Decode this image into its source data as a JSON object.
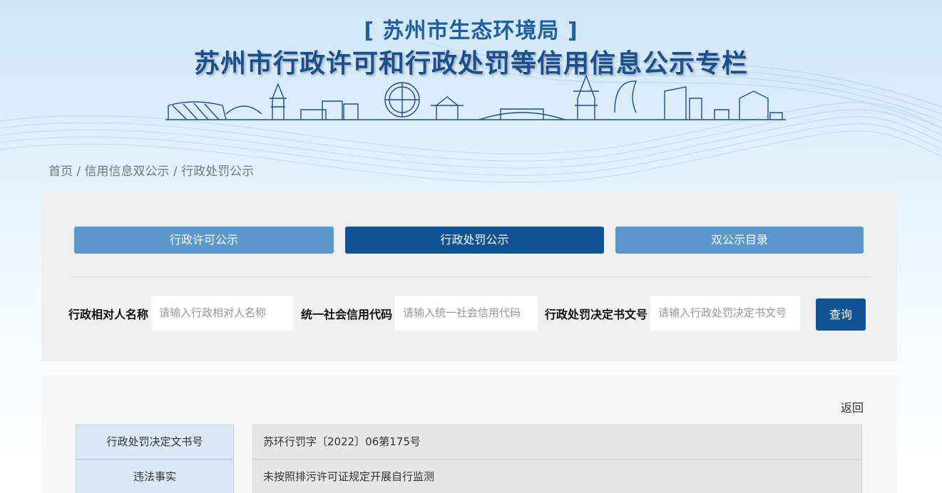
{
  "header": {
    "org": "[ 苏州市生态环境局 ]",
    "title": "苏州市行政许可和行政处罚等信用信息公示专栏"
  },
  "breadcrumb": {
    "home": "首页",
    "sep1": " / ",
    "section": "信用信息双公示",
    "sep2": " / ",
    "current": "行政处罚公示"
  },
  "tabs": [
    {
      "label": "行政许可公示",
      "active": false
    },
    {
      "label": "行政处罚公示",
      "active": true
    },
    {
      "label": "双公示目录",
      "active": false
    }
  ],
  "search": {
    "name_label": "行政相对人名称",
    "name_placeholder": "请输入行政相对人名称",
    "code_label": "统一社会信用代码",
    "code_placeholder": "请输入统一社会信用代码",
    "doc_label": "行政处罚决定书文号",
    "doc_placeholder": "请输入行政处罚决定书文号",
    "submit": "查询"
  },
  "detail": {
    "back": "返回",
    "rows": [
      {
        "label": "行政处罚决定文书号",
        "value": "苏环行罚字〔2022〕06第175号"
      },
      {
        "label": "违法事实",
        "value": "未按照排污许可证规定开展自行监测"
      }
    ]
  },
  "colors": {
    "primary": "#0f5394",
    "tab_inactive": "#5a97cd",
    "title": "#1a4f8f"
  }
}
